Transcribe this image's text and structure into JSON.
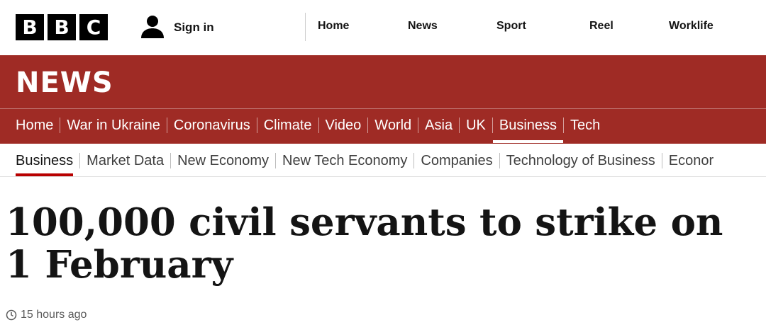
{
  "brand": {
    "logo_letters": [
      "B",
      "B",
      "C"
    ]
  },
  "account": {
    "signin_label": "Sign in",
    "icon": "person-icon"
  },
  "top_nav": [
    {
      "label": "Home"
    },
    {
      "label": "News"
    },
    {
      "label": "Sport"
    },
    {
      "label": "Reel"
    },
    {
      "label": "Worklife"
    }
  ],
  "section": {
    "title": "NEWS",
    "color": "#9f2b25"
  },
  "news_nav": [
    {
      "label": "Home"
    },
    {
      "label": "War in Ukraine"
    },
    {
      "label": "Coronavirus"
    },
    {
      "label": "Climate"
    },
    {
      "label": "Video"
    },
    {
      "label": "World"
    },
    {
      "label": "Asia"
    },
    {
      "label": "UK"
    },
    {
      "label": "Business",
      "active": true
    },
    {
      "label": "Tech"
    }
  ],
  "sub_nav": [
    {
      "label": "Business",
      "active": true
    },
    {
      "label": "Market Data"
    },
    {
      "label": "New Economy"
    },
    {
      "label": "New Tech Economy"
    },
    {
      "label": "Companies"
    },
    {
      "label": "Technology of Business"
    },
    {
      "label": "Econor"
    }
  ],
  "article": {
    "headline": "100,000 civil servants to strike on 1 February",
    "timestamp": "15 hours ago",
    "timestamp_icon": "clock-icon"
  },
  "colors": {
    "accent_underline": "#b80000",
    "nav_text": "#ffffff"
  }
}
